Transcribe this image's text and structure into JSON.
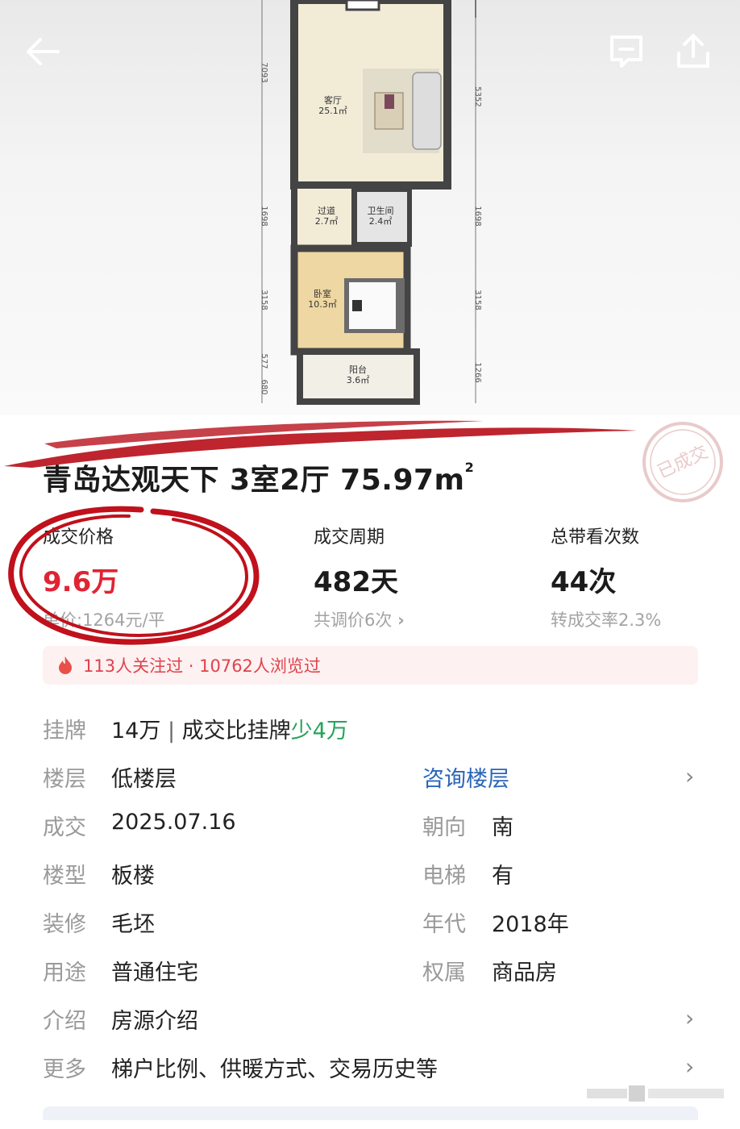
{
  "header": {
    "back_icon": "arrow-left-icon",
    "chat_icon": "chat-bubble-icon",
    "share_icon": "share-upload-icon"
  },
  "floorplan": {
    "rooms": [
      {
        "name": "客厅",
        "area": "25.1㎡"
      },
      {
        "name": "过道",
        "area": "2.7㎡"
      },
      {
        "name": "卫生间",
        "area": "2.4㎡"
      },
      {
        "name": "卧室",
        "area": "10.3㎡"
      },
      {
        "name": "阳台",
        "area": "3.6㎡"
      }
    ],
    "left_dims": [
      "7093",
      "1698",
      "3158",
      "577",
      "680"
    ],
    "right_dims": [
      "5352",
      "1698",
      "3158",
      "1266"
    ]
  },
  "listing": {
    "title": "青岛达观天下 3室2厅 75.97m",
    "title_sup": "2",
    "stamp_text": "已成交",
    "stats": [
      {
        "label": "成交价格",
        "value": "9.6万",
        "sub": "单价:1264元/平"
      },
      {
        "label": "成交周期",
        "value": "482天",
        "sub": "共调价6次"
      },
      {
        "label": "总带看次数",
        "value": "44次",
        "sub": "转成交率2.3%"
      }
    ],
    "attention": "113人关注过 · 10762人浏览过",
    "details": {
      "listing_key": "挂牌",
      "listing_value": "14万",
      "listing_sep": "|",
      "listing_compare": "成交比挂牌",
      "listing_diff": "少4万",
      "floor_key": "楼层",
      "floor_value": "低楼层",
      "floor_link": "咨询楼层",
      "deal_key": "成交",
      "deal_value": "2025.07.16",
      "orient_key": "朝向",
      "orient_value": "南",
      "type_key": "楼型",
      "type_value": "板楼",
      "elevator_key": "电梯",
      "elevator_value": "有",
      "deco_key": "装修",
      "deco_value": "毛坯",
      "year_key": "年代",
      "year_value": "2018年",
      "use_key": "用途",
      "use_value": "普通住宅",
      "own_key": "权属",
      "own_value": "商品房",
      "intro_key": "介绍",
      "intro_value": "房源介绍",
      "more_key": "更多",
      "more_value": "梯户比例、供暖方式、交易历史等"
    }
  },
  "colors": {
    "price_red": "#e02434",
    "link_blue": "#2b66b8",
    "diff_green": "#25a35b",
    "hint_red": "#e0424c"
  }
}
